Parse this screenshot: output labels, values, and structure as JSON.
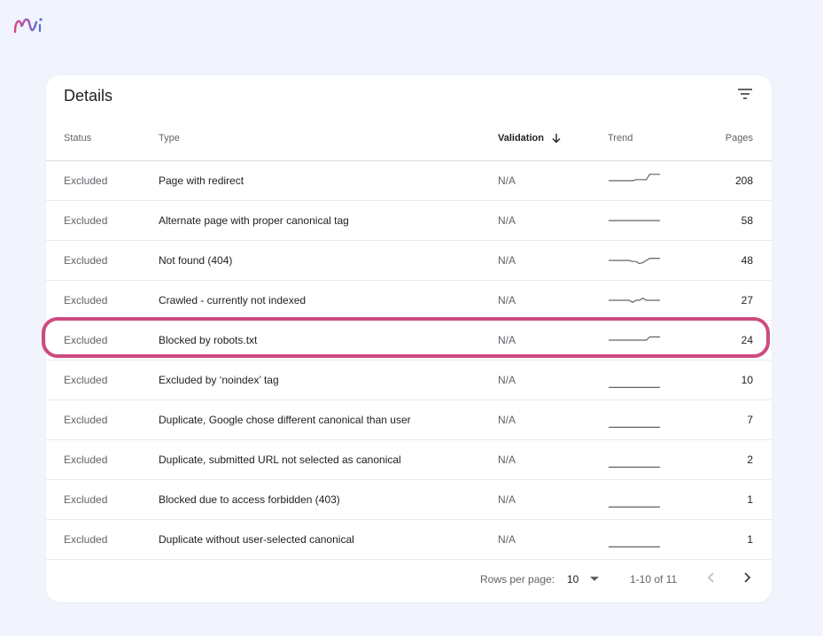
{
  "colors": {
    "background": "#f1f4fd",
    "highlight": "#cd4b7f",
    "logo_pink": "#d6458d",
    "logo_blue": "#5a70d8"
  },
  "icons": {
    "logo": "brand-logo-icon",
    "filter": "filter-icon",
    "sort": "arrow-down-icon",
    "caret": "caret-down-icon",
    "prev": "chevron-left-icon",
    "next": "chevron-right-icon"
  },
  "card": {
    "title": "Details"
  },
  "table": {
    "columns": {
      "status": "Status",
      "type": "Type",
      "validation": "Validation",
      "trend": "Trend",
      "pages": "Pages"
    },
    "rows": [
      {
        "status": "Excluded",
        "type": "Page with redirect",
        "validation": "N/A",
        "pages": "208",
        "trend": [
          0.5,
          0.5,
          0.5,
          0.5,
          0.5,
          0.5,
          0.5,
          0.5,
          0.45,
          0.45,
          0.45,
          0.45,
          0.2,
          0.2,
          0.2,
          0.2
        ]
      },
      {
        "status": "Excluded",
        "type": "Alternate page with proper canonical tag",
        "validation": "N/A",
        "pages": "58",
        "trend": [
          0.5,
          0.5,
          0.5,
          0.5,
          0.5,
          0.5,
          0.5,
          0.5,
          0.5,
          0.5,
          0.5,
          0.5,
          0.5,
          0.5,
          0.5,
          0.5
        ]
      },
      {
        "status": "Excluded",
        "type": "Not found (404)",
        "validation": "N/A",
        "pages": "48",
        "trend": [
          0.5,
          0.5,
          0.5,
          0.5,
          0.5,
          0.5,
          0.5,
          0.55,
          0.55,
          0.65,
          0.6,
          0.5,
          0.4,
          0.4,
          0.4,
          0.4
        ]
      },
      {
        "status": "Excluded",
        "type": "Crawled - currently not indexed",
        "validation": "N/A",
        "pages": "27",
        "trend": [
          0.5,
          0.5,
          0.5,
          0.5,
          0.5,
          0.5,
          0.5,
          0.6,
          0.5,
          0.5,
          0.4,
          0.5,
          0.5,
          0.5,
          0.5,
          0.5
        ]
      },
      {
        "status": "Excluded",
        "type": "Blocked by robots.txt",
        "validation": "N/A",
        "pages": "24",
        "trend": [
          0.5,
          0.5,
          0.5,
          0.5,
          0.5,
          0.5,
          0.5,
          0.5,
          0.5,
          0.5,
          0.5,
          0.5,
          0.35,
          0.35,
          0.35,
          0.35
        ]
      },
      {
        "status": "Excluded",
        "type": "Excluded by ‘noindex’ tag",
        "validation": "N/A",
        "pages": "10",
        "trend": [
          0.85,
          0.85,
          0.85,
          0.85,
          0.85,
          0.85,
          0.85,
          0.85,
          0.85,
          0.85,
          0.85,
          0.85,
          0.85,
          0.85,
          0.85,
          0.85
        ]
      },
      {
        "status": "Excluded",
        "type": "Duplicate, Google chose different canonical than user",
        "validation": "N/A",
        "pages": "7",
        "trend": [
          0.85,
          0.85,
          0.85,
          0.85,
          0.85,
          0.85,
          0.85,
          0.85,
          0.85,
          0.85,
          0.85,
          0.85,
          0.85,
          0.85,
          0.85,
          0.85
        ]
      },
      {
        "status": "Excluded",
        "type": "Duplicate, submitted URL not selected as canonical",
        "validation": "N/A",
        "pages": "2",
        "trend": [
          0.85,
          0.85,
          0.85,
          0.85,
          0.85,
          0.85,
          0.85,
          0.85,
          0.85,
          0.85,
          0.85,
          0.85,
          0.85,
          0.85,
          0.85,
          0.85
        ]
      },
      {
        "status": "Excluded",
        "type": "Blocked due to access forbidden (403)",
        "validation": "N/A",
        "pages": "1",
        "trend": [
          0.85,
          0.85,
          0.85,
          0.85,
          0.85,
          0.85,
          0.85,
          0.85,
          0.85,
          0.85,
          0.85,
          0.85,
          0.85,
          0.85,
          0.85,
          0.85
        ]
      },
      {
        "status": "Excluded",
        "type": "Duplicate without user-selected canonical",
        "validation": "N/A",
        "pages": "1",
        "trend": [
          0.85,
          0.85,
          0.85,
          0.85,
          0.85,
          0.85,
          0.85,
          0.85,
          0.85,
          0.85,
          0.85,
          0.85,
          0.85,
          0.85,
          0.85,
          0.85
        ]
      }
    ],
    "highlighted_row": 4
  },
  "pagination": {
    "rows_per_page_label": "Rows per page:",
    "rows_per_page_value": "10",
    "range": "1-10 of 11"
  }
}
